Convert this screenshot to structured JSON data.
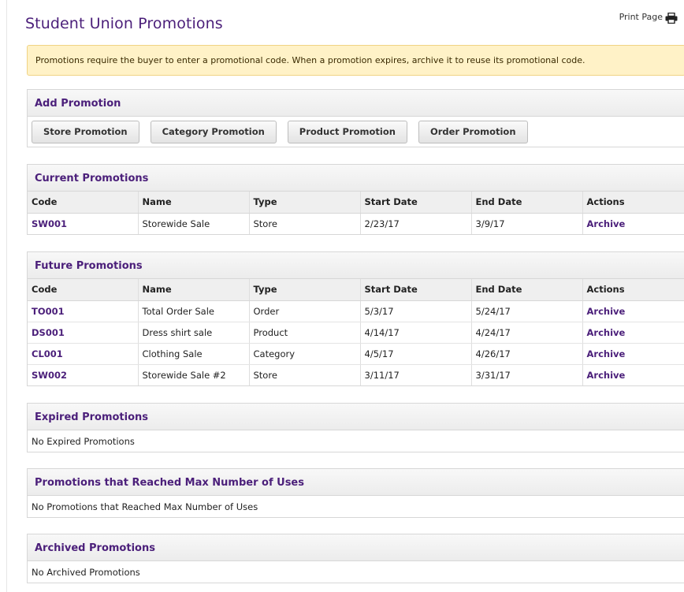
{
  "page": {
    "title": "Student Union Promotions",
    "print_label": "Print Page",
    "notice": "Promotions require the buyer to enter a promotional code. When a promotion expires, archive it to reuse its promotional code."
  },
  "add_promotion": {
    "heading": "Add Promotion",
    "buttons": [
      "Store Promotion",
      "Category Promotion",
      "Product Promotion",
      "Order Promotion"
    ]
  },
  "columns": [
    "Code",
    "Name",
    "Type",
    "Start Date",
    "End Date",
    "Actions"
  ],
  "current": {
    "heading": "Current Promotions",
    "rows": [
      {
        "code": "SW001",
        "name": "Storewide Sale",
        "type": "Store",
        "start": "2/23/17",
        "end": "3/9/17",
        "action": "Archive"
      }
    ]
  },
  "future": {
    "heading": "Future Promotions",
    "rows": [
      {
        "code": "TO001",
        "name": "Total Order Sale",
        "type": "Order",
        "start": "5/3/17",
        "end": "5/24/17",
        "action": "Archive"
      },
      {
        "code": "DS001",
        "name": "Dress shirt sale",
        "type": "Product",
        "start": "4/14/17",
        "end": "4/24/17",
        "action": "Archive"
      },
      {
        "code": "CL001",
        "name": "Clothing Sale",
        "type": "Category",
        "start": "4/5/17",
        "end": "4/26/17",
        "action": "Archive"
      },
      {
        "code": "SW002",
        "name": "Storewide Sale #2",
        "type": "Store",
        "start": "3/11/17",
        "end": "3/31/17",
        "action": "Archive"
      }
    ]
  },
  "expired": {
    "heading": "Expired Promotions",
    "empty": "No Expired Promotions"
  },
  "max_uses": {
    "heading": "Promotions that Reached Max Number of Uses",
    "empty": "No Promotions that Reached Max Number of Uses"
  },
  "archived": {
    "heading": "Archived Promotions",
    "empty": "No Archived Promotions"
  }
}
